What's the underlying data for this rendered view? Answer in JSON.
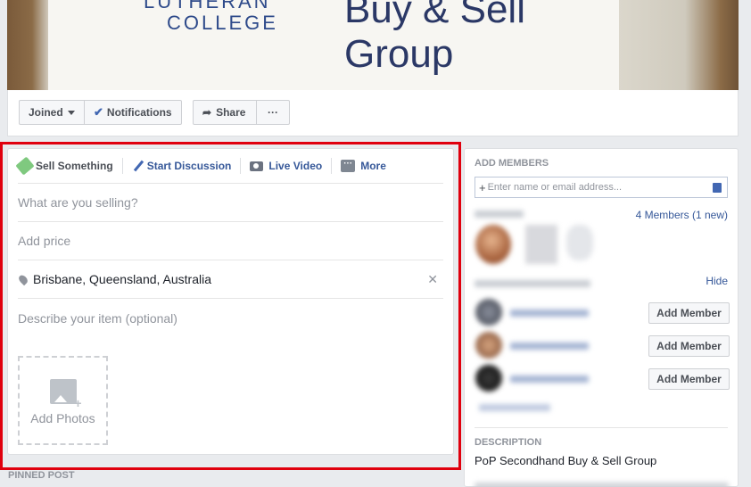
{
  "cover": {
    "college_line1": "LUTHERAN",
    "college_line2": "COLLEGE",
    "title": "Buy & Sell Group"
  },
  "actions": {
    "joined": "Joined",
    "notifications": "Notifications",
    "share": "Share",
    "more": "···"
  },
  "composer": {
    "tabs": [
      "Sell Something",
      "Start Discussion",
      "Live Video",
      "More"
    ],
    "item_placeholder": "What are you selling?",
    "price_placeholder": "Add price",
    "location": "Brisbane, Queensland, Australia",
    "description_placeholder": "Describe your item (optional)",
    "add_photos": "Add Photos"
  },
  "pinned_post": "PINNED POST",
  "right": {
    "add_members_head": "ADD MEMBERS",
    "add_members_placeholder": "Enter name or email address...",
    "members_count": "4 Members (1 new)",
    "hide": "Hide",
    "add_member_button": "Add Member",
    "description_head": "DESCRIPTION",
    "description_text": "PoP Secondhand Buy & Sell Group"
  }
}
